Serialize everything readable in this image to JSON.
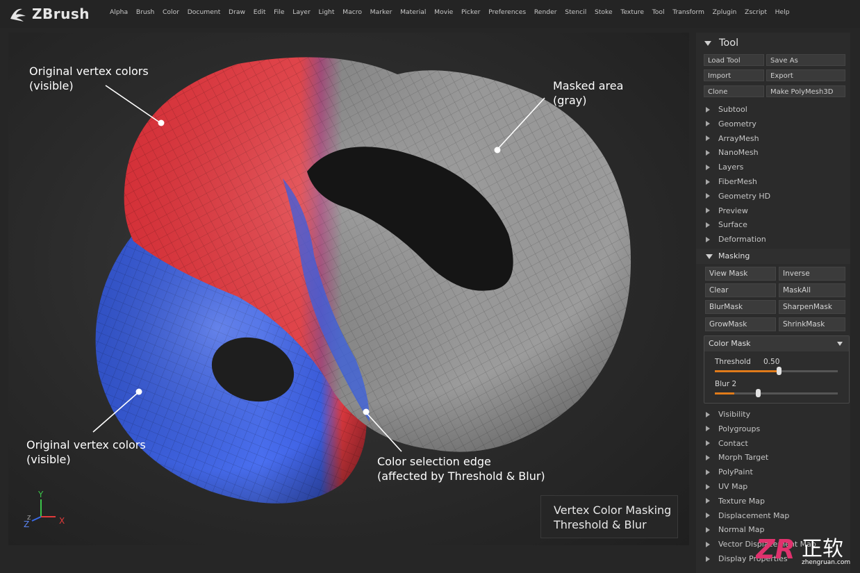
{
  "app": {
    "name": "ZBrush"
  },
  "menu": [
    "Alpha",
    "Brush",
    "Color",
    "Document",
    "Draw",
    "Edit",
    "File",
    "Layer",
    "Light",
    "Macro",
    "Marker",
    "Material",
    "Movie",
    "Picker",
    "Preferences",
    "Render",
    "Stencil",
    "Stoke",
    "Texture",
    "Tool",
    "Transform",
    "Zplugin",
    "Zscript",
    "Help"
  ],
  "viewport": {
    "callouts": {
      "top_left": [
        "Original vertex colors",
        "(visible)"
      ],
      "bottom_left": [
        "Original vertex colors",
        "(visible)"
      ],
      "top_right": [
        "Masked area",
        "(gray)"
      ],
      "bottom_right": [
        "Color selection edge",
        "(affected by Threshold & Blur)"
      ]
    },
    "label_box": [
      "Vertex Color Masking",
      "Threshold & Blur"
    ],
    "gizmo": {
      "y": "Y",
      "z": "Z",
      "x": "X"
    }
  },
  "panel": {
    "title": "Tool",
    "buttons": [
      "Load Tool",
      "Save As",
      "Import",
      "Export",
      "Clone",
      "Make PolyMesh3D"
    ],
    "sections_top": [
      "Subtool",
      "Geometry",
      "ArrayMesh",
      "NanoMesh",
      "Layers",
      "FiberMesh",
      "Geometry HD",
      "Preview",
      "Surface",
      "Deformation"
    ],
    "masking": {
      "title": "Masking",
      "buttons": [
        "View Mask",
        "Inverse",
        "Clear",
        "MaskAll",
        "BlurMask",
        "SharpenMask",
        "GrowMask",
        "ShrinkMask"
      ],
      "color_mask": {
        "title": "Color Mask",
        "threshold_label": "Threshold",
        "threshold_value": "0.50",
        "threshold_fraction": 0.52,
        "blur_label": "Blur",
        "blur_value": "2",
        "blur_fraction": 0.35
      }
    },
    "sections_bottom": [
      "Visibility",
      "Polygroups",
      "Contact",
      "Morph Target",
      "PolyPaint",
      "UV Map",
      "Texture Map",
      "Displacement Map",
      "Normal Map",
      "Vector Displacement Map",
      "Display Properties"
    ]
  },
  "watermark": {
    "text": "正软",
    "sub": "zhengruan.com"
  },
  "colors": {
    "accent": "#e07b1a",
    "red_mesh": "#e33a3f",
    "blue_mesh": "#3d63e0",
    "gray_mesh": "#8a8a8a"
  }
}
